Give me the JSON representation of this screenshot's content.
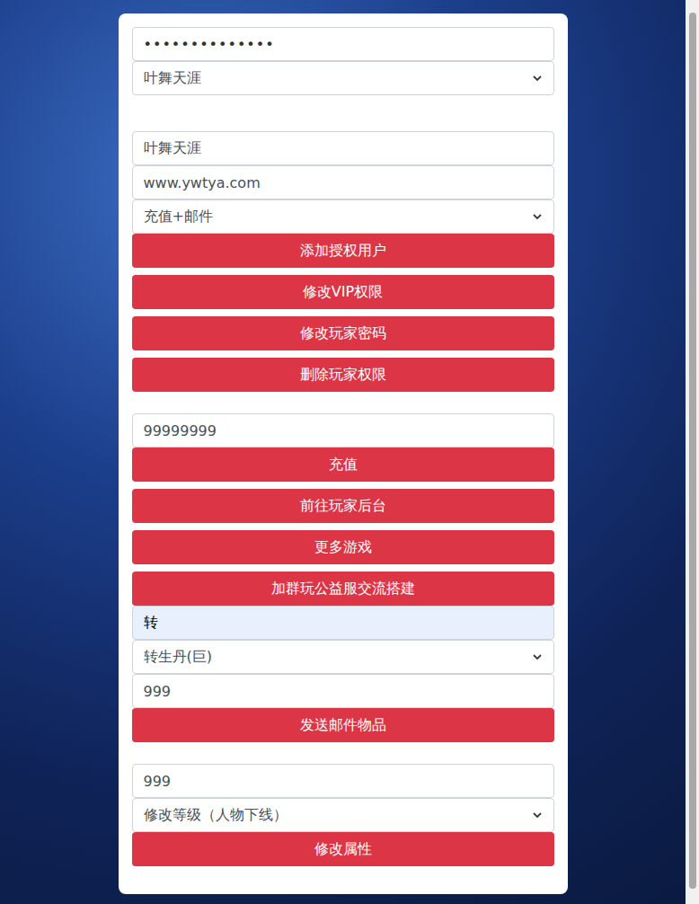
{
  "login": {
    "password": "••••••••••••••",
    "server": "叶舞天涯"
  },
  "auth": {
    "username": "叶舞天涯",
    "password": "www.ywtya.com",
    "permission": "充值+邮件",
    "buttons": [
      "添加授权用户",
      "修改VIP权限",
      "修改玩家密码",
      "删除玩家权限"
    ]
  },
  "recharge": {
    "amount": "99999999",
    "buttons": [
      "充值",
      "前往玩家后台",
      "更多游戏",
      "加群玩公益服交流搭建"
    ]
  },
  "mail": {
    "search": {
      "value": "转",
      "autofilled": true
    },
    "item": "转生丹(巨)",
    "quantity": "999",
    "button": "发送邮件物品"
  },
  "attribute": {
    "value": "999",
    "action": "修改等级（人物下线）",
    "button": "修改属性"
  }
}
